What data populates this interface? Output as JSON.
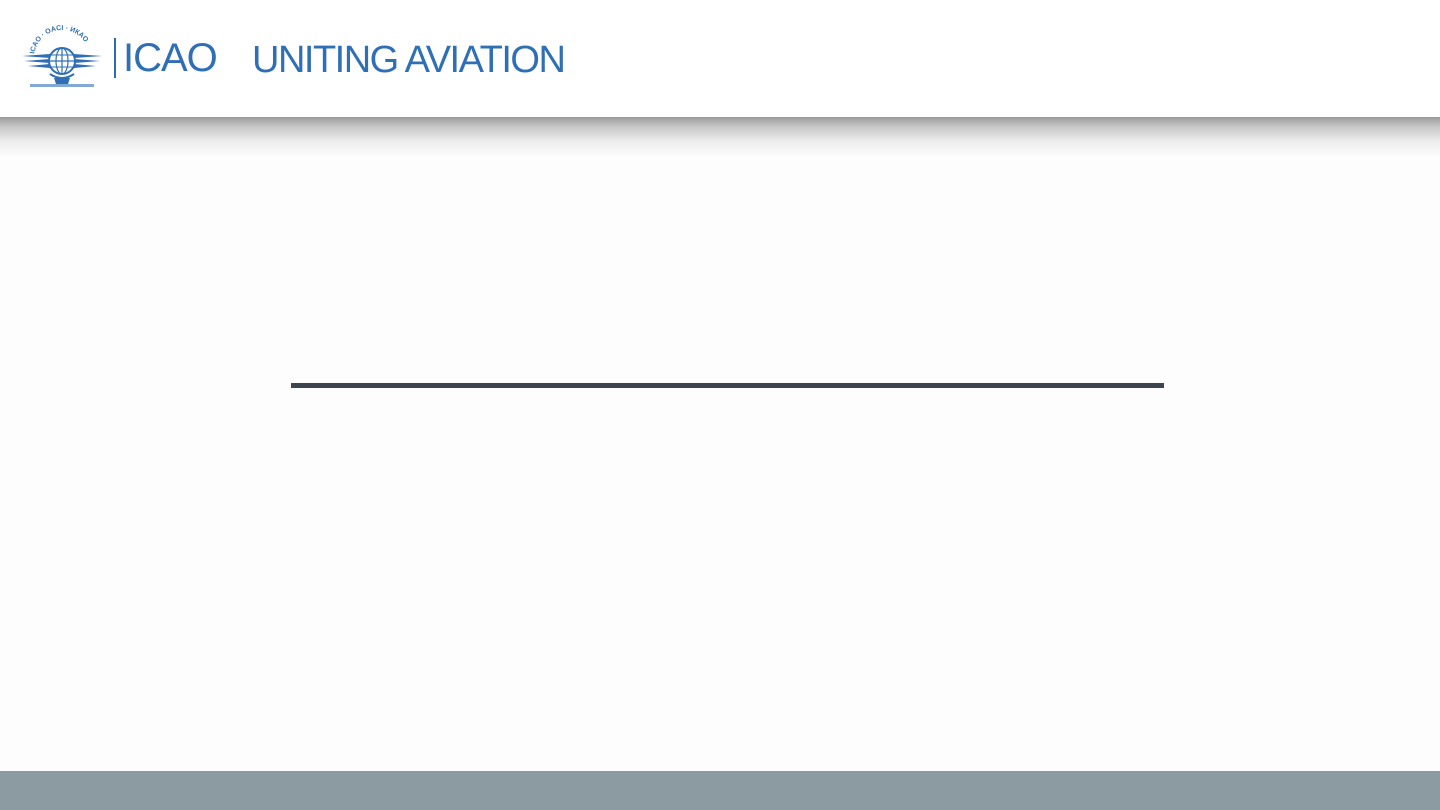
{
  "header": {
    "logo_icon": "icao-emblem-icon",
    "logo_ring_text": "ICAO · OACI · ИКАО",
    "brand_name": "ICAO",
    "tagline": "UNITING AVIATION"
  },
  "colors": {
    "brand_blue": "#2f6fb5",
    "rule": "#3d4650",
    "footer": "#8c9aa1",
    "background": "#fdfdfd"
  }
}
